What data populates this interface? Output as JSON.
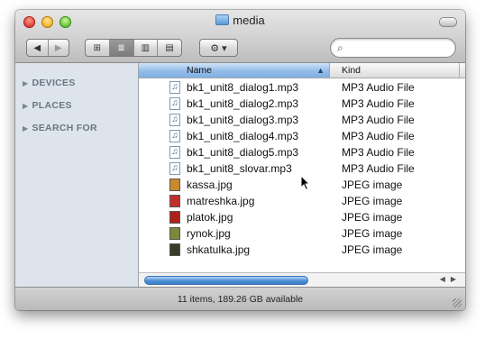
{
  "window": {
    "title": "media"
  },
  "toolbar": {
    "back_glyph": "◀",
    "forward_glyph": "▶",
    "view_icons": "⊞",
    "view_list": "≣",
    "view_columns": "▥",
    "view_coverflow": "▤",
    "action_glyph": "⚙ ▾",
    "search_placeholder": "",
    "search_value": ""
  },
  "sidebar": {
    "sections": [
      {
        "label": "DEVICES"
      },
      {
        "label": "PLACES"
      },
      {
        "label": "SEARCH FOR"
      }
    ]
  },
  "list": {
    "columns": {
      "name": "Name",
      "kind": "Kind",
      "sort_glyph": "▲"
    },
    "rows": [
      {
        "name": "bk1_unit8_dialog1.mp3",
        "kind": "MP3 Audio File",
        "icon": "audio-file-icon"
      },
      {
        "name": "bk1_unit8_dialog2.mp3",
        "kind": "MP3 Audio File",
        "icon": "audio-file-icon"
      },
      {
        "name": "bk1_unit8_dialog3.mp3",
        "kind": "MP3 Audio File",
        "icon": "audio-file-icon"
      },
      {
        "name": "bk1_unit8_dialog4.mp3",
        "kind": "MP3 Audio File",
        "icon": "audio-file-icon"
      },
      {
        "name": "bk1_unit8_dialog5.mp3",
        "kind": "MP3 Audio File",
        "icon": "audio-file-icon"
      },
      {
        "name": "bk1_unit8_slovar.mp3",
        "kind": "MP3 Audio File",
        "icon": "audio-file-icon"
      },
      {
        "name": "kassa.jpg",
        "kind": "JPEG image",
        "icon": "image-file-icon"
      },
      {
        "name": "matreshka.jpg",
        "kind": "JPEG image",
        "icon": "image-file-icon"
      },
      {
        "name": "platok.jpg",
        "kind": "JPEG image",
        "icon": "image-file-icon"
      },
      {
        "name": "rynok.jpg",
        "kind": "JPEG image",
        "icon": "image-file-icon"
      },
      {
        "name": "shkatulka.jpg",
        "kind": "JPEG image",
        "icon": "image-file-icon"
      }
    ]
  },
  "status": {
    "text": "11 items, 189.26 GB available"
  },
  "colors": {
    "kassa_thumb": "#c98a2e",
    "matreshka_thumb": "#c0302a",
    "platok_thumb": "#b0201b",
    "rynok_thumb": "#7a8a3a",
    "shkatulka_thumb": "#3a3a2a"
  }
}
